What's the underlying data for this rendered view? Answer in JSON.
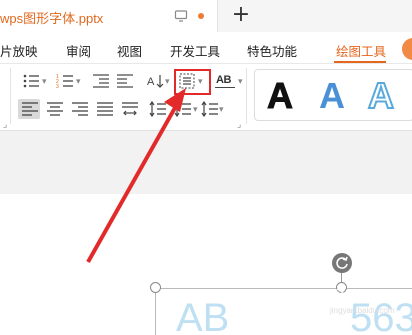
{
  "tab": {
    "title": "wps图形字体.pptx"
  },
  "menu": {
    "items": [
      "片放映",
      "审阅",
      "视图",
      "开发工具",
      "特色功能",
      "绘图工具"
    ],
    "active_index": 5
  },
  "ribbon": {
    "text_box_label": "AB",
    "wordart_styles": [
      "A",
      "A",
      "A"
    ]
  },
  "canvas": {
    "text_left": "AB",
    "text_right": "563"
  },
  "watermark": {
    "brand": "Baidu经验",
    "url": "jingyan.baidu.com"
  },
  "colors": {
    "accent": "#e5661d",
    "annotation": "#e22a2a"
  }
}
